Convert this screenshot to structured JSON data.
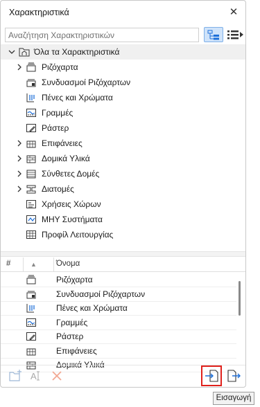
{
  "window": {
    "title": "Χαρακτηριστικά",
    "close_label": "✕"
  },
  "search": {
    "placeholder": "Αναζήτηση Χαρακτηριστικών",
    "value": ""
  },
  "tree": {
    "root_label": "Όλα τα Χαρακτηριστικά",
    "items": [
      {
        "label": "Ριζόχαρτα",
        "expandable": true,
        "icon": "pens-stack-icon"
      },
      {
        "label": "Συνδυασμοί Ριζόχαρτων",
        "expandable": false,
        "icon": "pen-sets-icon"
      },
      {
        "label": "Πένες και Χρώματα",
        "expandable": false,
        "icon": "pens-colors-icon"
      },
      {
        "label": "Γραμμές",
        "expandable": false,
        "icon": "line-types-icon"
      },
      {
        "label": "Ράστερ",
        "expandable": false,
        "icon": "fill-icon"
      },
      {
        "label": "Επιφάνειες",
        "expandable": true,
        "icon": "surfaces-icon"
      },
      {
        "label": "Δομικά Υλικά",
        "expandable": true,
        "icon": "building-materials-icon"
      },
      {
        "label": "Σύνθετες Δομές",
        "expandable": true,
        "icon": "composites-icon"
      },
      {
        "label": "Διατομές",
        "expandable": true,
        "icon": "profiles-icon"
      },
      {
        "label": "Χρήσεις Χώρων",
        "expandable": false,
        "icon": "zone-categories-icon"
      },
      {
        "label": "ΜΗΥ Συστήματα",
        "expandable": false,
        "icon": "mep-systems-icon"
      },
      {
        "label": "Προφίλ Λειτουργίας",
        "expandable": false,
        "icon": "operation-profiles-icon"
      }
    ]
  },
  "list": {
    "headers": {
      "num": "#",
      "sort": "▲",
      "name": "Όνομα"
    },
    "rows": [
      {
        "label": "Ριζόχαρτα",
        "icon": "pens-stack-icon"
      },
      {
        "label": "Συνδυασμοί Ριζόχαρτων",
        "icon": "pen-sets-icon"
      },
      {
        "label": "Πένες και Χρώματα",
        "icon": "pens-colors-icon"
      },
      {
        "label": "Γραμμές",
        "icon": "line-types-icon"
      },
      {
        "label": "Ράστερ",
        "icon": "fill-icon"
      },
      {
        "label": "Επιφάνειες",
        "icon": "surfaces-icon"
      },
      {
        "label": "Δομικά Υλικά",
        "icon": "building-materials-icon"
      }
    ]
  },
  "footer": {
    "tooltip": "Εισαγωγή"
  },
  "colors": {
    "accent": "#1e6fd9",
    "highlight": "#e0201b",
    "selected_bg": "#cfe3fa"
  }
}
